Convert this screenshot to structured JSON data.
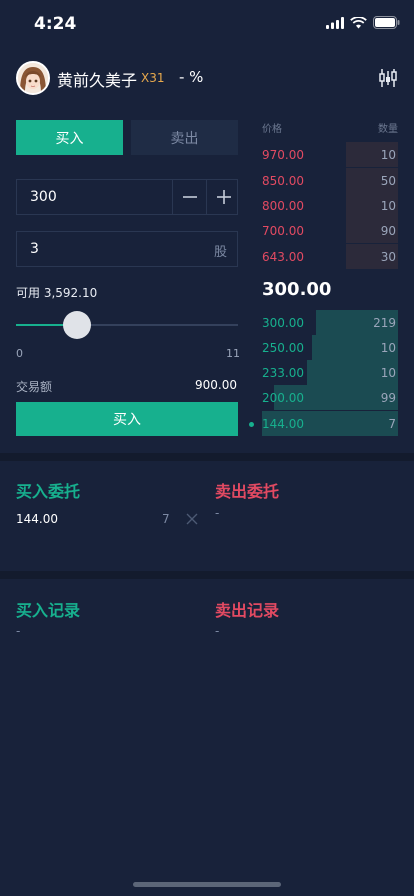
{
  "status_bar": {
    "time": "4:24"
  },
  "header": {
    "name": "黄前久美子",
    "badge": "X31",
    "change": "- %"
  },
  "trade": {
    "tabs": [
      {
        "label": "买入"
      },
      {
        "label": "卖出"
      }
    ],
    "price_value": "300",
    "quantity_value": "3",
    "quantity_unit": "股",
    "available_label": "可用 3,592.10",
    "slider": {
      "min_label": "0",
      "max_label": "11",
      "value": 3,
      "max": 11
    },
    "amount_label": "交易额",
    "amount_value": "900.00",
    "submit_label": "买入"
  },
  "order_book": {
    "price_header": "价格",
    "qty_header": "数量",
    "asks": [
      {
        "price": "970.00",
        "qty": "10",
        "depth": 0.38
      },
      {
        "price": "850.00",
        "qty": "50",
        "depth": 0.38
      },
      {
        "price": "800.00",
        "qty": "10",
        "depth": 0.38
      },
      {
        "price": "700.00",
        "qty": "90",
        "depth": 0.38
      },
      {
        "price": "643.00",
        "qty": "30",
        "depth": 0.38
      }
    ],
    "last_price": "300.00",
    "bids": [
      {
        "price": "300.00",
        "qty": "219",
        "depth": 0.6
      },
      {
        "price": "250.00",
        "qty": "10",
        "depth": 0.63
      },
      {
        "price": "233.00",
        "qty": "10",
        "depth": 0.67
      },
      {
        "price": "200.00",
        "qty": "99",
        "depth": 0.91
      },
      {
        "price": "144.00",
        "qty": "7",
        "depth": 1.0
      }
    ]
  },
  "orders": {
    "buy_title": "买入委托",
    "sell_title": "卖出委托",
    "buy_items": [
      {
        "price": "144.00",
        "qty": "7"
      }
    ],
    "sell_placeholder": "-"
  },
  "records": {
    "buy_title": "买入记录",
    "sell_title": "卖出记录",
    "buy_placeholder": "-",
    "sell_placeholder": "-"
  },
  "colors": {
    "buy": "#17b08e",
    "sell": "#e24a62",
    "background": "#18223a"
  }
}
